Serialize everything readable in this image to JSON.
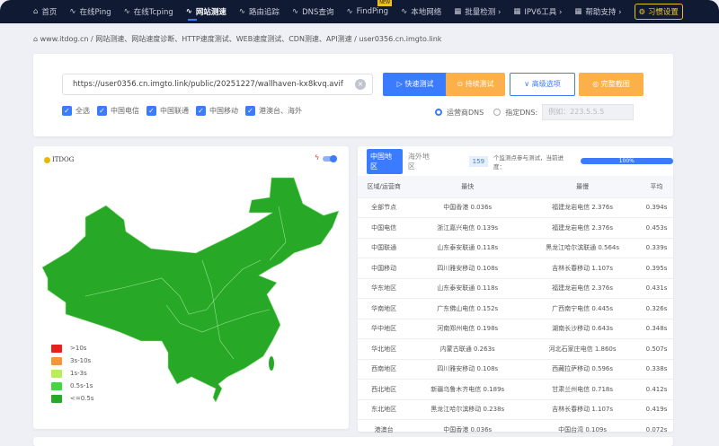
{
  "nav": {
    "items": [
      {
        "label": "首页",
        "icon": "home-icon"
      },
      {
        "label": "在线Ping",
        "icon": "pulse-icon"
      },
      {
        "label": "在线Tcping",
        "icon": "pulse-icon"
      },
      {
        "label": "网站测速",
        "icon": "pulse-icon",
        "active": true
      },
      {
        "label": "路由追踪",
        "icon": "pulse-icon"
      },
      {
        "label": "DNS查询",
        "icon": "pulse-icon"
      },
      {
        "label": "FindPing",
        "icon": "pulse-icon",
        "badge": "NEW"
      },
      {
        "label": "本地网络",
        "icon": "pulse-icon"
      },
      {
        "label": "批量检测 ›",
        "icon": "grid-icon"
      },
      {
        "label": "IPV6工具 ›",
        "icon": "grid-icon"
      },
      {
        "label": "帮助支持 ›",
        "icon": "grid-icon"
      }
    ],
    "habit": "习惯设置"
  },
  "breadcrumb": {
    "home": "www.itdog.cn",
    "section": "网站测速、网站速度诊断、HTTP速度测试、WEB速度测试、CDN测速、API测速",
    "current": "user0356.cn.imgto.link",
    "sep": "/"
  },
  "form": {
    "url": "https://user0356.cn.imgto.link/public/20251227/wallhaven-kx8kvq.avif",
    "buttons": {
      "fast": "▷ 快速测试",
      "continuous": "⊙ 持续测试",
      "advanced": "∨ 高级选项",
      "screenshot": "◎ 完整截图"
    },
    "checks": [
      "全选",
      "中国电信",
      "中国联通",
      "中国移动",
      "港澳台、海外"
    ],
    "dns_isp": "运营商DNS",
    "dns_custom": "指定DNS:",
    "dns_placeholder": "例如：223.5.5.5"
  },
  "map": {
    "logo": "ITDOG",
    "legend": [
      {
        "label": ">10s",
        "color": "#e8201c"
      },
      {
        "label": "3s-10s",
        "color": "#f5963a"
      },
      {
        "label": "1s-3s",
        "color": "#b9ee5a"
      },
      {
        "label": "0.5s-1s",
        "color": "#3fd840"
      },
      {
        "label": "<=0.5s",
        "color": "#27a927"
      }
    ],
    "fill": "#27a927"
  },
  "results": {
    "tabs": [
      "中国地区",
      "海外地区"
    ],
    "count": "159",
    "count_text": "个监测点参与测试，当前进度：",
    "progress": 100,
    "progress_label": "100%",
    "headers": [
      "区域/运营商",
      "最快",
      "最慢",
      "平均"
    ],
    "rows": [
      [
        "全部节点",
        "中国香港 0.036s",
        "福建龙岩电信 2.376s",
        "0.394s"
      ],
      [
        "中国电信",
        "浙江嘉兴电信 0.139s",
        "福建龙岩电信 2.376s",
        "0.453s"
      ],
      [
        "中国联通",
        "山东泰安联通 0.118s",
        "黑龙江哈尔滨联通 0.564s",
        "0.339s"
      ],
      [
        "中国移动",
        "四川雅安移动 0.108s",
        "吉林长春移动 1.107s",
        "0.395s"
      ],
      [
        "华东地区",
        "山东泰安联通 0.118s",
        "福建龙岩电信 2.376s",
        "0.431s"
      ],
      [
        "华南地区",
        "广东佛山电信 0.152s",
        "广西南宁电信 0.445s",
        "0.326s"
      ],
      [
        "华中地区",
        "河南郑州电信 0.198s",
        "湖南长沙移动 0.643s",
        "0.348s"
      ],
      [
        "华北地区",
        "内蒙古联通 0.263s",
        "河北石家庄电信 1.860s",
        "0.507s"
      ],
      [
        "西南地区",
        "四川雅安移动 0.108s",
        "西藏拉萨移动 0.596s",
        "0.338s"
      ],
      [
        "西北地区",
        "新疆乌鲁木齐电信 0.189s",
        "甘肃兰州电信 0.718s",
        "0.412s"
      ],
      [
        "东北地区",
        "黑龙江哈尔滨移动 0.238s",
        "吉林长春移动 1.107s",
        "0.419s"
      ],
      [
        "港澳台",
        "中国香港 0.036s",
        "中国台湾 0.109s",
        "0.072s"
      ]
    ]
  }
}
